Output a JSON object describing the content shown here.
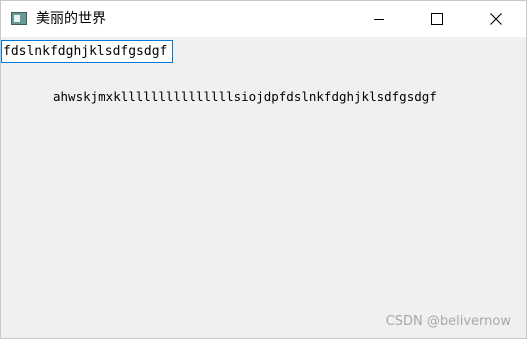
{
  "window": {
    "title": "美丽的世界",
    "icon": "app-icon"
  },
  "controls": {
    "minimize_icon": "minimize-icon",
    "maximize_icon": "maximize-icon",
    "close_icon": "close-icon"
  },
  "content": {
    "input_value": "fdslnkfdghjklsdfgsdgf",
    "label_text": "ahwskjmxklllllllllllllllsiojdpfdslnkfdghjklsdfgsdgf"
  },
  "watermark": {
    "text": "CSDN @belivernow"
  },
  "colors": {
    "input_focus_border": "#0078d7",
    "window_background": "#f0f0f0",
    "titlebar_background": "#ffffff",
    "watermark": "#a8a8a8"
  }
}
